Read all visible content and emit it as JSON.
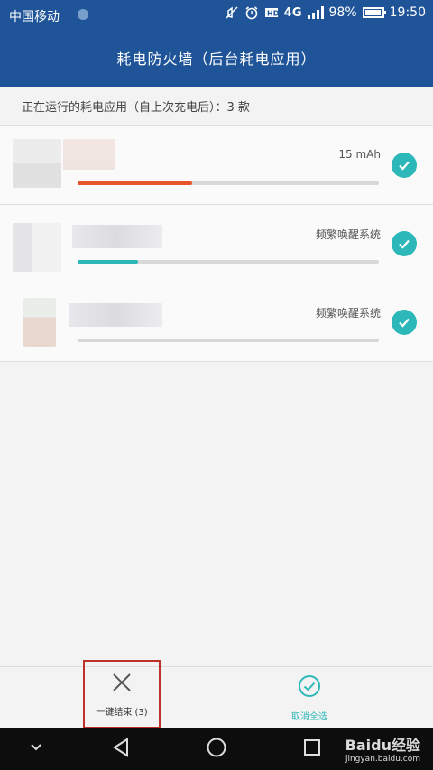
{
  "status_bar": {
    "carrier": "中国移动",
    "network": "4G",
    "battery": "98%",
    "battery_level": 0.98,
    "time": "19:50",
    "icons": [
      "mute-icon",
      "alarm-icon",
      "hd-icon",
      "4g-icon",
      "signal-icon",
      "battery-icon"
    ]
  },
  "header": {
    "title": "耗电防火墙（后台耗电应用）"
  },
  "summary": {
    "text": "正在运行的耗电应用（自上次充电后）：3 款"
  },
  "apps": [
    {
      "value": "15 mAh",
      "usage_fraction": 0.38,
      "bar_color": "#e8542c",
      "checked": true
    },
    {
      "value": "频繁唤醒系统",
      "usage_fraction": 0.2,
      "bar_color": "#2cb7b8",
      "checked": true
    },
    {
      "value": "频繁唤醒系统",
      "usage_fraction": 0.0,
      "bar_color": "#2cb7b8",
      "checked": true
    }
  ],
  "bottom_actions": {
    "end_all_label": "一键结束 (3)",
    "cancel_select_label": "取消全选"
  },
  "watermark": {
    "main": "Baidu经验",
    "sub": "jingyan.baidu.com"
  },
  "colors": {
    "header_blue": "#1f5598",
    "accent_teal": "#2cb7b8",
    "highlight_red": "#c0302b"
  }
}
